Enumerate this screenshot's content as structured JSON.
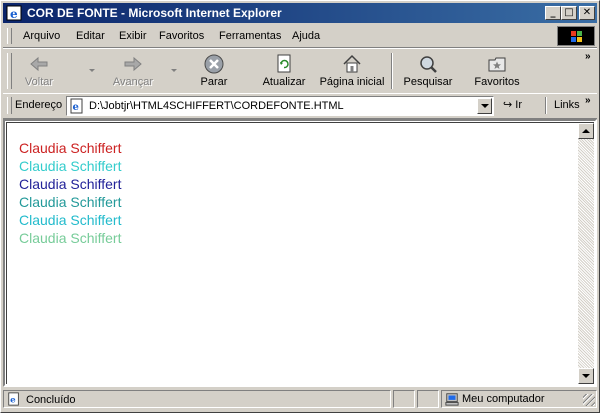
{
  "window": {
    "title": "COR DE FONTE - Microsoft Internet Explorer"
  },
  "menubar": {
    "items": [
      {
        "label": "Arquivo"
      },
      {
        "label": "Editar"
      },
      {
        "label": "Exibir"
      },
      {
        "label": "Favoritos"
      },
      {
        "label": "Ferramentas"
      },
      {
        "label": "Ajuda"
      }
    ]
  },
  "toolbar": {
    "back": "Voltar",
    "forward": "Avançar",
    "stop": "Parar",
    "refresh": "Atualizar",
    "home": "Página inicial",
    "search": "Pesquisar",
    "favorites": "Favoritos"
  },
  "addressbar": {
    "label": "Endereço",
    "url": "D:\\Jobtjr\\HTML4SCHIFFERT\\CORDEFONTE.HTML",
    "go": "Ir",
    "links": "Links"
  },
  "page": {
    "lines": [
      {
        "text": "Claudia Schiffert",
        "color": "#cc2222"
      },
      {
        "text": "Claudia Schiffert",
        "color": "#33cccc"
      },
      {
        "text": "Claudia Schiffert",
        "color": "#222299"
      },
      {
        "text": "Claudia Schiffert",
        "color": "#229999"
      },
      {
        "text": "Claudia Schiffert",
        "color": "#22bbcc"
      },
      {
        "text": "Claudia Schiffert",
        "color": "#77cc99"
      }
    ]
  },
  "status": {
    "text": "Concluído",
    "zone": "Meu computador"
  }
}
